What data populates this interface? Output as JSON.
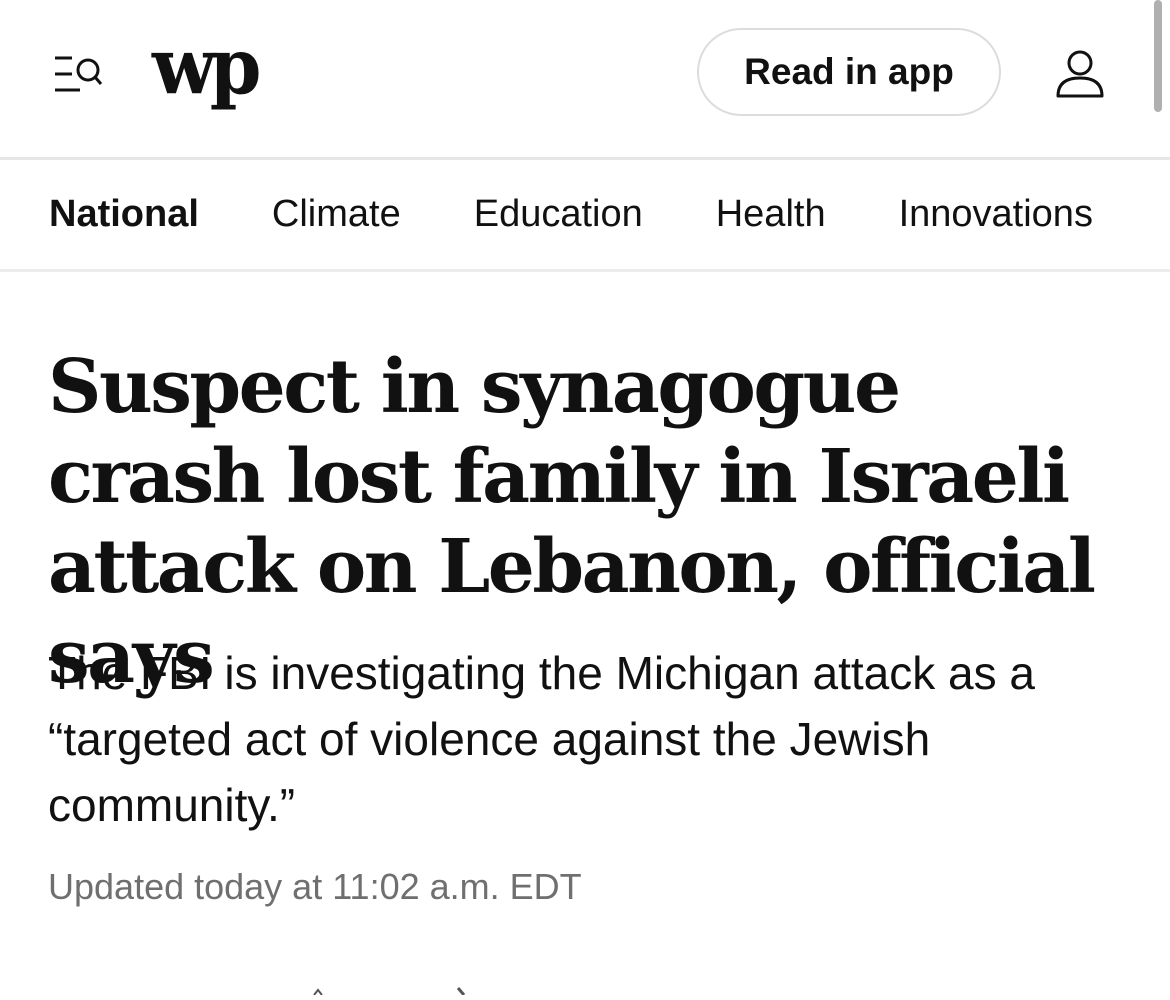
{
  "header": {
    "logo_text": "wp",
    "read_in_app_label": "Read in app",
    "menu_icon": "menu-search-icon",
    "user_icon": "user-icon"
  },
  "subnav": {
    "items": [
      {
        "label": "National",
        "active": true
      },
      {
        "label": "Climate",
        "active": false
      },
      {
        "label": "Education",
        "active": false
      },
      {
        "label": "Health",
        "active": false
      },
      {
        "label": "Innovations",
        "active": false
      }
    ]
  },
  "article": {
    "headline": "Suspect in synagogue crash lost family in Israeli attack on Lebanon, official says",
    "dek": "The FBI is investigating the Michigan attack as a “targeted act of violence against the Jewish community.”",
    "timestamp": "Updated today at 11:02 a.m. EDT"
  },
  "colors": {
    "text": "#111111",
    "muted": "#6f6f6f",
    "divider": "#e6e6e6",
    "button_border": "#dcdcdc"
  }
}
